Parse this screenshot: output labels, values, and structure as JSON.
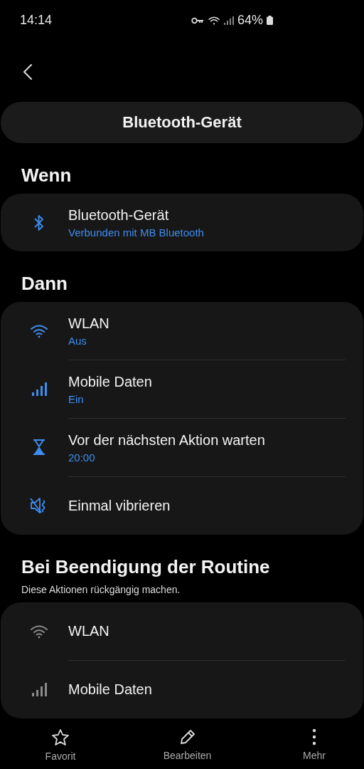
{
  "status_bar": {
    "time": "14:14",
    "battery": "64%"
  },
  "header": {
    "title": "Bluetooth-Gerät"
  },
  "sections": [
    {
      "heading": "Wenn",
      "accent": true,
      "items": [
        {
          "kind": "bluetooth",
          "title": "Bluetooth-Gerät",
          "subtitle": "Verbunden mit MB Bluetooth"
        }
      ]
    },
    {
      "heading": "Dann",
      "accent": true,
      "items": [
        {
          "kind": "wifi",
          "title": "WLAN",
          "subtitle": "Aus"
        },
        {
          "kind": "signal",
          "title": "Mobile Daten",
          "subtitle": "Ein"
        },
        {
          "kind": "hourglass",
          "title": "Vor der nächsten Aktion warten",
          "subtitle": "20:00"
        },
        {
          "kind": "vibrate",
          "title": "Einmal vibrieren"
        }
      ]
    },
    {
      "heading": "Bei Beendigung der Routine",
      "description": "Diese Aktionen rückgängig machen.",
      "accent": false,
      "items": [
        {
          "kind": "wifi",
          "title": "WLAN"
        },
        {
          "kind": "signal",
          "title": "Mobile Daten"
        }
      ]
    }
  ],
  "bottom_nav": [
    {
      "kind": "star",
      "label": "Favorit"
    },
    {
      "kind": "pencil",
      "label": "Bearbeiten"
    },
    {
      "kind": "more",
      "label": "Mehr"
    }
  ]
}
